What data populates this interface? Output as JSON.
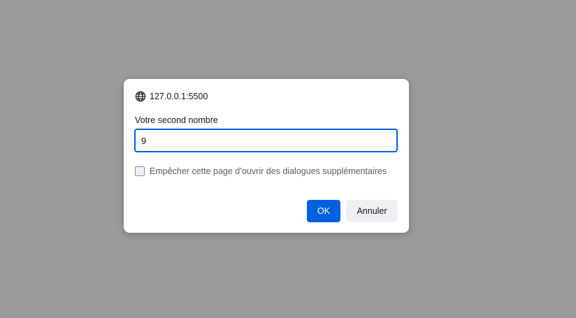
{
  "dialog": {
    "origin": "127.0.0.1:5500",
    "origin_icon": "globe-icon",
    "prompt_label": "Votre second nombre",
    "input_value": "9",
    "checkbox_label": "Empêcher cette page d’ouvrir des dialogues supplémentaires",
    "checkbox_checked": false,
    "ok_label": "OK",
    "cancel_label": "Annuler"
  },
  "colors": {
    "backdrop": "#9b9b9d",
    "accent": "#0061e0",
    "dialog_bg": "#ffffff"
  }
}
